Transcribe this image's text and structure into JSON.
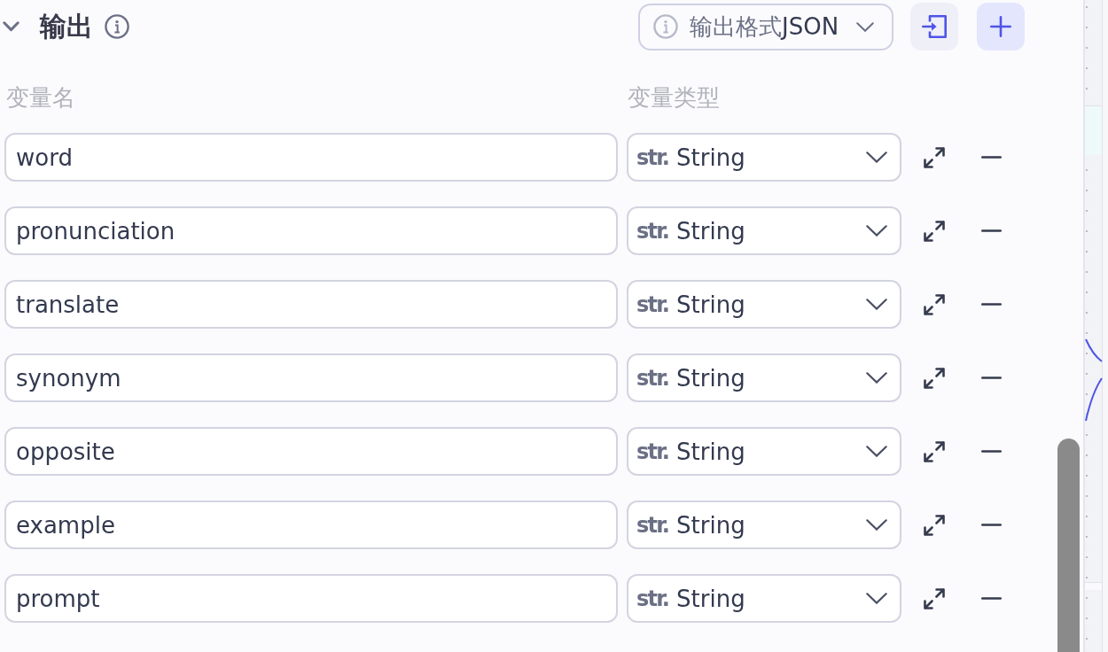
{
  "section": {
    "title": "输出",
    "expanded": true
  },
  "output_format": {
    "label": "输出格式",
    "value": "JSON"
  },
  "columns": [
    "变量名",
    "变量类型"
  ],
  "variables": [
    {
      "name": "word",
      "type_tag": "str.",
      "type": "String"
    },
    {
      "name": "pronunciation",
      "type_tag": "str.",
      "type": "String"
    },
    {
      "name": "translate",
      "type_tag": "str.",
      "type": "String"
    },
    {
      "name": "synonym",
      "type_tag": "str.",
      "type": "String"
    },
    {
      "name": "opposite",
      "type_tag": "str.",
      "type": "String"
    },
    {
      "name": "example",
      "type_tag": "str.",
      "type": "String"
    },
    {
      "name": "prompt",
      "type_tag": "str.",
      "type": "String"
    }
  ]
}
